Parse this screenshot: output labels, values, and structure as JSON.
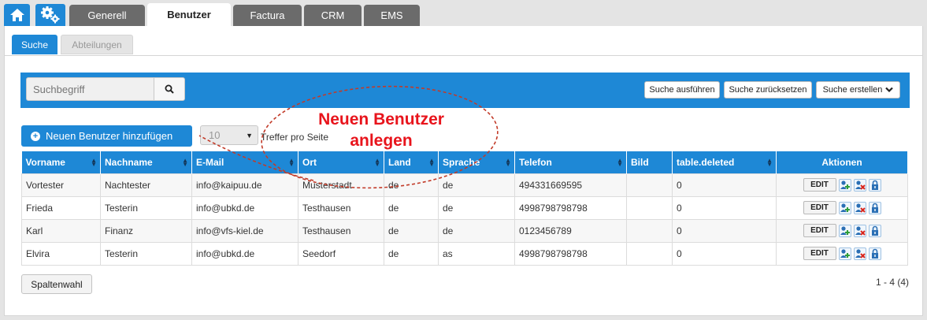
{
  "topnav": {
    "home_icon": "home-icon",
    "settings_icon": "gears-icon",
    "tabs": [
      {
        "label": "Generell"
      },
      {
        "label": "Benutzer"
      },
      {
        "label": "Factura"
      },
      {
        "label": "CRM"
      },
      {
        "label": "EMS"
      }
    ],
    "active_tab": "Benutzer"
  },
  "subnav": {
    "tabs": [
      {
        "label": "Suche"
      },
      {
        "label": "Abteilungen"
      }
    ],
    "active_tab": "Suche"
  },
  "search": {
    "placeholder": "Suchbegriff",
    "run_label": "Suche ausführen",
    "reset_label": "Suche zurücksetzen",
    "create_label": "Suche erstellen"
  },
  "toolbar": {
    "add_user_label": "Neuen Benutzer hinzufügen",
    "per_page_value": "10",
    "per_page_label": "Treffer pro Seite"
  },
  "annotation": {
    "line1": "Neuen Benutzer",
    "line2": "anlegen",
    "color": "#e8141c"
  },
  "table": {
    "columns": [
      "Vorname",
      "Nachname",
      "E-Mail",
      "Ort",
      "Land",
      "Sprache",
      "Telefon",
      "Bild",
      "table.deleted",
      "Aktionen"
    ],
    "rows": [
      {
        "vorname": "Vortester",
        "nachname": "Nachtester",
        "email": "info@kaipuu.de",
        "ort": "Musterstadt",
        "land": "de",
        "sprache": "de",
        "telefon": "494331669595",
        "bild": "",
        "deleted": "0"
      },
      {
        "vorname": "Frieda",
        "nachname": "Testerin",
        "email": "info@ubkd.de",
        "ort": "Testhausen",
        "land": "de",
        "sprache": "de",
        "telefon": "4998798798798",
        "bild": "",
        "deleted": "0"
      },
      {
        "vorname": "Karl",
        "nachname": "Finanz",
        "email": "info@vfs-kiel.de",
        "ort": "Testhausen",
        "land": "de",
        "sprache": "de",
        "telefon": "0123456789",
        "bild": "",
        "deleted": "0"
      },
      {
        "vorname": "Elvira",
        "nachname": "Testerin",
        "email": "info@ubkd.de",
        "ort": "Seedorf",
        "land": "de",
        "sprache": "as",
        "telefon": "4998798798798",
        "bild": "",
        "deleted": "0"
      }
    ],
    "edit_label": "EDIT"
  },
  "footer": {
    "columns_label": "Spaltenwahl",
    "pager_text": "1 - 4 (4)"
  },
  "colors": {
    "accent": "#1e88d6",
    "tab_inactive": "#6b6b6b",
    "annotation": "#e8141c"
  }
}
